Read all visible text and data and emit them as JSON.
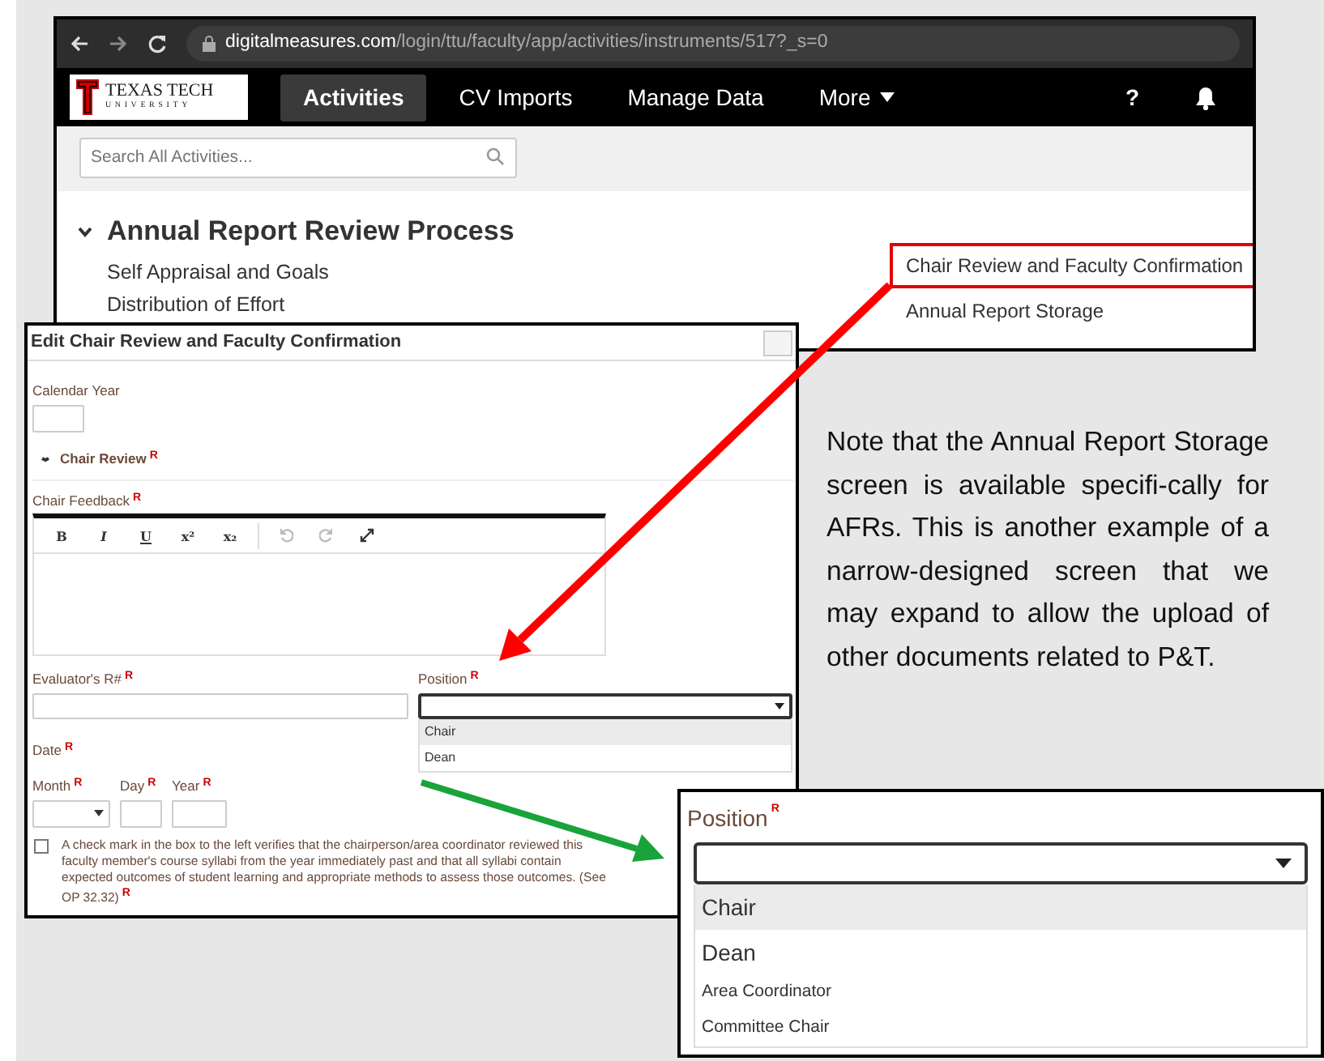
{
  "browser": {
    "url_domain": "digitalmeasures.com",
    "url_path": "/login/ttu/faculty/app/activities/instruments/517?_s=0"
  },
  "navbar": {
    "logo_text": "TEXAS TECH",
    "logo_subtext": "UNIVERSITY",
    "items": [
      {
        "label": "Activities",
        "selected": true,
        "dropdown": false
      },
      {
        "label": "CV Imports",
        "selected": false,
        "dropdown": false
      },
      {
        "label": "Manage Data",
        "selected": false,
        "dropdown": false
      },
      {
        "label": "More",
        "selected": false,
        "dropdown": true
      }
    ],
    "help": "?"
  },
  "search": {
    "placeholder": "Search All Activities..."
  },
  "section": {
    "title": "Annual Report Review Process",
    "expanded": true,
    "left_links": [
      "Self Appraisal and Goals",
      "Distribution of Effort"
    ],
    "right_links": [
      {
        "label": "Chair Review and Faculty Confirmation",
        "highlighted": true
      },
      {
        "label": "Annual Report Storage",
        "highlighted": false
      }
    ]
  },
  "edit_form": {
    "title": "Edit Chair Review and Faculty Confirmation",
    "calendar_year": {
      "label": "Calendar Year"
    },
    "chair_review": {
      "label": "Chair Review",
      "required": "R",
      "expanded": true
    },
    "chair_feedback": {
      "label": "Chair Feedback",
      "required": "R",
      "toolbar": [
        "B",
        "I",
        "U",
        "x²",
        "x₂"
      ]
    },
    "evaluator": {
      "label": "Evaluator's R#",
      "required": "R"
    },
    "position": {
      "label": "Position",
      "required": "R",
      "options": [
        {
          "label": "Chair",
          "highlighted": true
        },
        {
          "label": "Dean",
          "highlighted": false
        }
      ]
    },
    "date": {
      "label": "Date",
      "required": "R",
      "parts": [
        {
          "label": "Month",
          "required": "R",
          "kind": "select"
        },
        {
          "label": "Day",
          "required": "R",
          "kind": "input"
        },
        {
          "label": "Year",
          "required": "R",
          "kind": "input"
        }
      ]
    },
    "confirmation": {
      "checked": false,
      "text": "A check mark in the box to the left verifies that the chairperson/area coordinator reviewed this faculty member's course syllabi from the year immediately past and that all syllabi contain expected outcomes of student learning and appropriate methods to assess those outcomes. (See OP 32.32)",
      "required": "R"
    }
  },
  "position_zoom": {
    "label": "Position",
    "required": "R",
    "options": [
      {
        "label": "Chair",
        "highlighted": true,
        "kind": "large"
      },
      {
        "label": "Dean",
        "highlighted": false,
        "kind": "large"
      },
      {
        "label": "Area Coordinator",
        "highlighted": false,
        "kind": "small"
      },
      {
        "label": "Committee Chair",
        "highlighted": false,
        "kind": "small"
      }
    ]
  },
  "note": {
    "text": "Note that the Annual Report Storage screen is available specifi-cally for AFRs.  This is another example of a narrow-designed screen that we may expand to allow the upload of other documents related to P&T."
  }
}
